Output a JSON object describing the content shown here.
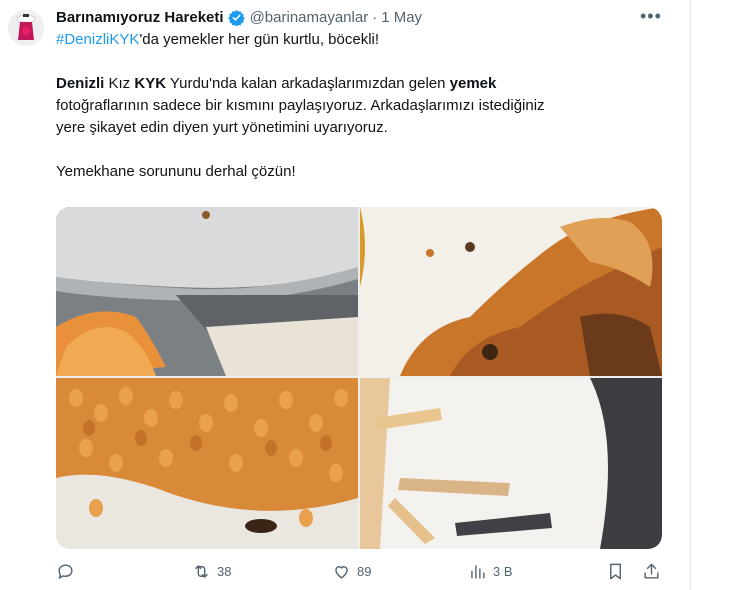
{
  "tweet": {
    "author_name": "Barınamıyoruz Hareketi",
    "handle": "@barinamayanlar",
    "separator": "·",
    "date": "1 May",
    "more_label": "•••",
    "line1_hashtag": "#DenizliKYK",
    "line1_rest": "'da yemekler her gün kurtlu, böcekli!",
    "line2_part1": "Denizli",
    "line2_part2": " Kız ",
    "line2_part3": "KYK",
    "line2_part4": " Yurdu'nda kalan arkadaşlarımızdan gelen ",
    "line2_part5": "yemek",
    "line3": "fotoğraflarının sadece bir kısmını paylaşıyoruz. Arkadaşlarımızı istediğiniz",
    "line4": "yere şikayet edin diyen yurt yönetimini uyarıyoruz.",
    "line5": "Yemekhane sorununu derhal çözün!"
  },
  "actions": {
    "reply_icon": "reply-icon",
    "retweet_count": "38",
    "like_count": "89",
    "views_count": "3 B"
  },
  "colors": {
    "accent": "#1d9bf0",
    "text": "#0f1419",
    "muted": "#536471"
  }
}
